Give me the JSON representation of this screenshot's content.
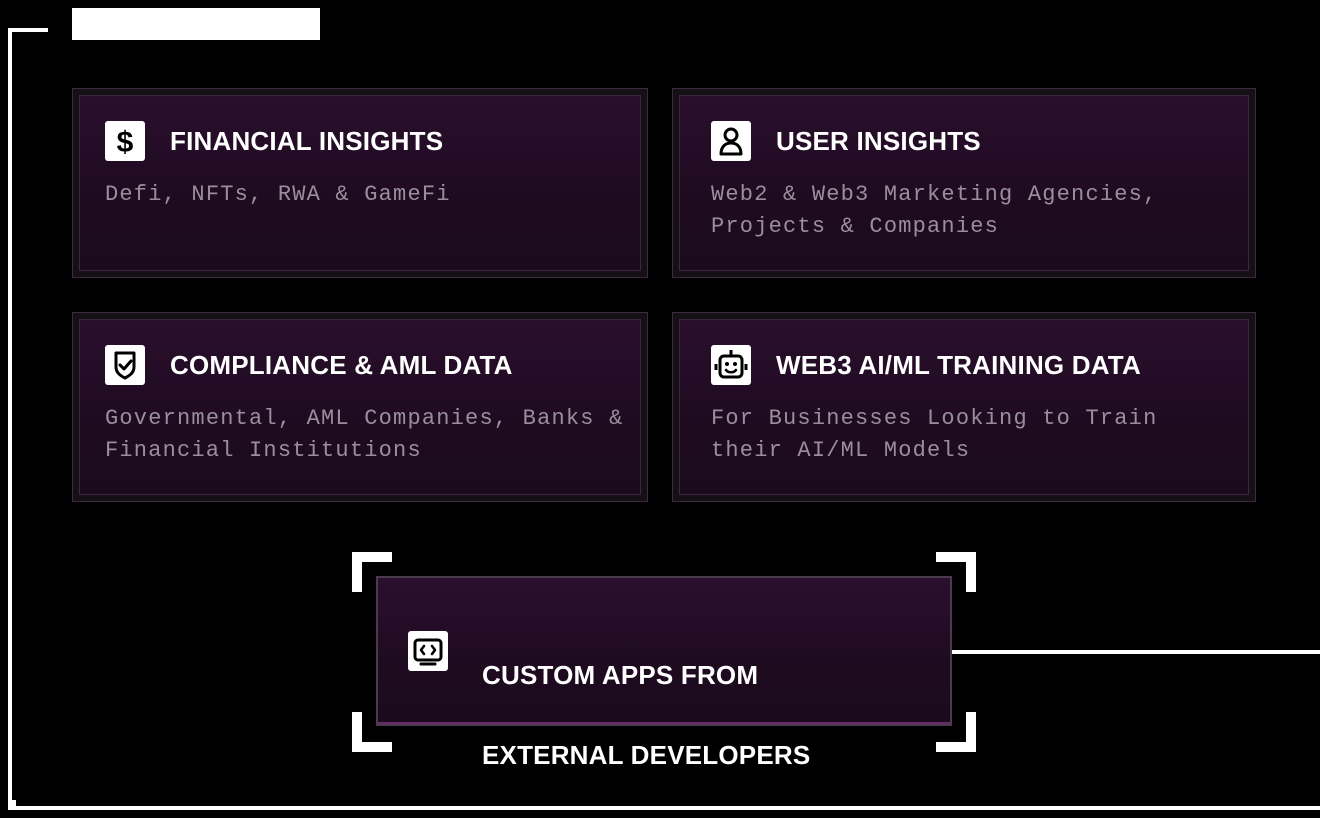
{
  "cards": [
    {
      "title": "FINANCIAL INSIGHTS",
      "description": "Defi, NFTs, RWA & GameFi",
      "icon": "dollar-icon"
    },
    {
      "title": "USER INSIGHTS",
      "description": "Web2 & Web3 Marketing Agencies, Projects & Companies",
      "icon": "user-icon"
    },
    {
      "title": "COMPLIANCE & AML DATA",
      "description": "Governmental, AML Companies, Banks & Financial Institutions",
      "icon": "shield-check-icon"
    },
    {
      "title": "WEB3 AI/ML TRAINING DATA",
      "description": "For Businesses Looking to Train their AI/ML Models",
      "icon": "robot-icon"
    }
  ],
  "custom_app": {
    "title_line1": "CUSTOM APPS FROM",
    "title_line2": "EXTERNAL DEVELOPERS",
    "icon": "code-window-icon"
  },
  "colors": {
    "background": "#000000",
    "card_fill": "#2b0f2e",
    "text_primary": "#ffffff",
    "text_secondary": "#9a8e9c"
  }
}
